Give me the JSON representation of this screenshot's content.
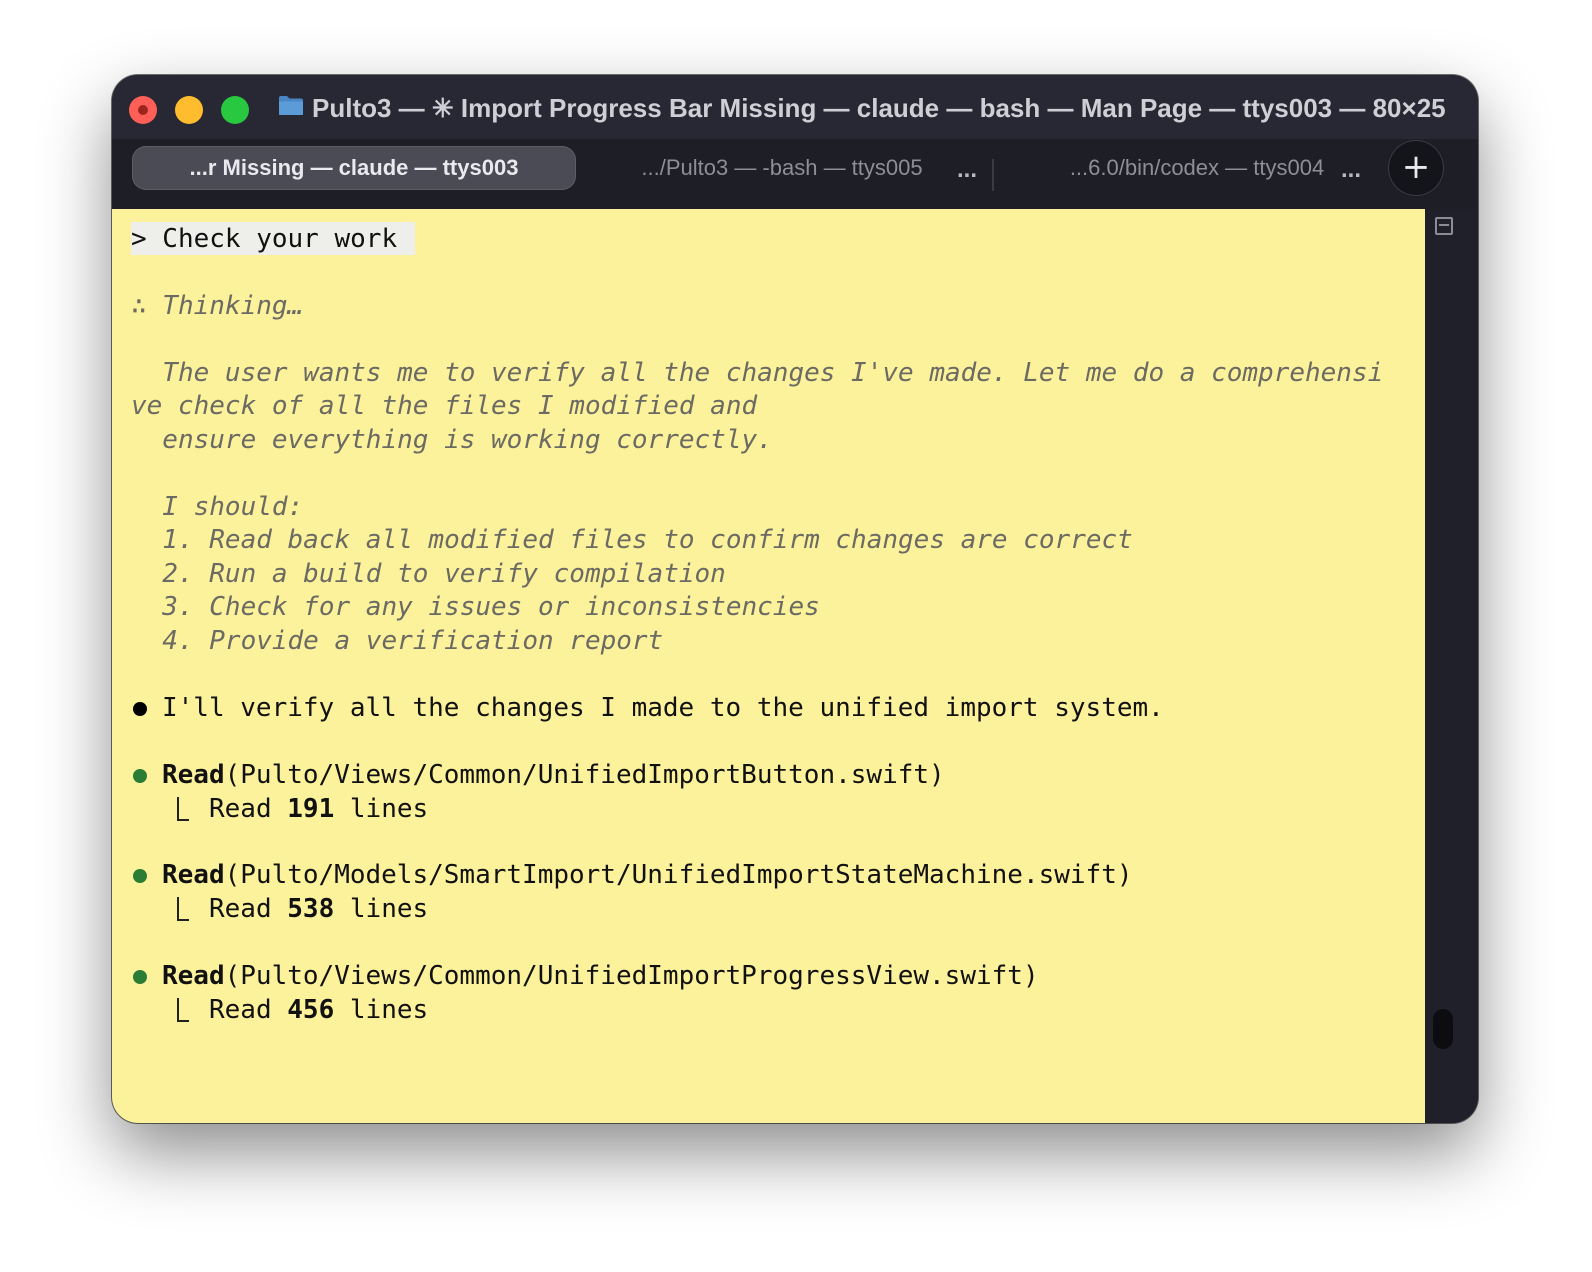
{
  "window": {
    "title": "Pulto3 — ✳ Import Progress Bar Missing — claude — bash — Man Page — ttys003 — 80×25"
  },
  "tabs": [
    {
      "label": "...r Missing — claude — ttys003",
      "active": true
    },
    {
      "label": ".../Pulto3 — -bash — ttys005",
      "active": false
    },
    {
      "label": "...6.0/bin/codex — ttys004",
      "active": false
    }
  ],
  "tab_more_label": "...",
  "new_tab_label": "+",
  "terminal": {
    "prompt": "> Check your work",
    "thinking_header": "∴ Thinking…",
    "thinking_lines": [
      "  The user wants me to verify all the changes I've made. Let me do a comprehensi",
      "ve check of all the files I modified and",
      "  ensure everything is working correctly.",
      "  I should:",
      "  1. Read back all modified files to confirm changes are correct",
      "  2. Run a build to verify compilation",
      "  3. Check for any issues or inconsistencies",
      "  4. Provide a verification report"
    ],
    "message": "I'll verify all the changes I made to the unified import system.",
    "tool_calls": [
      {
        "tool": "Read",
        "path": "(Pulto/Views/Common/UnifiedImportButton.swift)",
        "result_prefix": "Read ",
        "count": "191",
        "result_suffix": " lines"
      },
      {
        "tool": "Read",
        "path": "(Pulto/Models/SmartImport/UnifiedImportStateMachine.swift)",
        "result_prefix": "Read ",
        "count": "538",
        "result_suffix": " lines"
      },
      {
        "tool": "Read",
        "path": "(Pulto/Views/Common/UnifiedImportProgressView.swift)",
        "result_prefix": "Read ",
        "count": "456",
        "result_suffix": " lines"
      }
    ]
  },
  "colors": {
    "terminal_background": "#fcf29b",
    "window_chrome": "#272833",
    "tool_dot": "#2b7d35",
    "thinking_text": "#6b6a63"
  }
}
